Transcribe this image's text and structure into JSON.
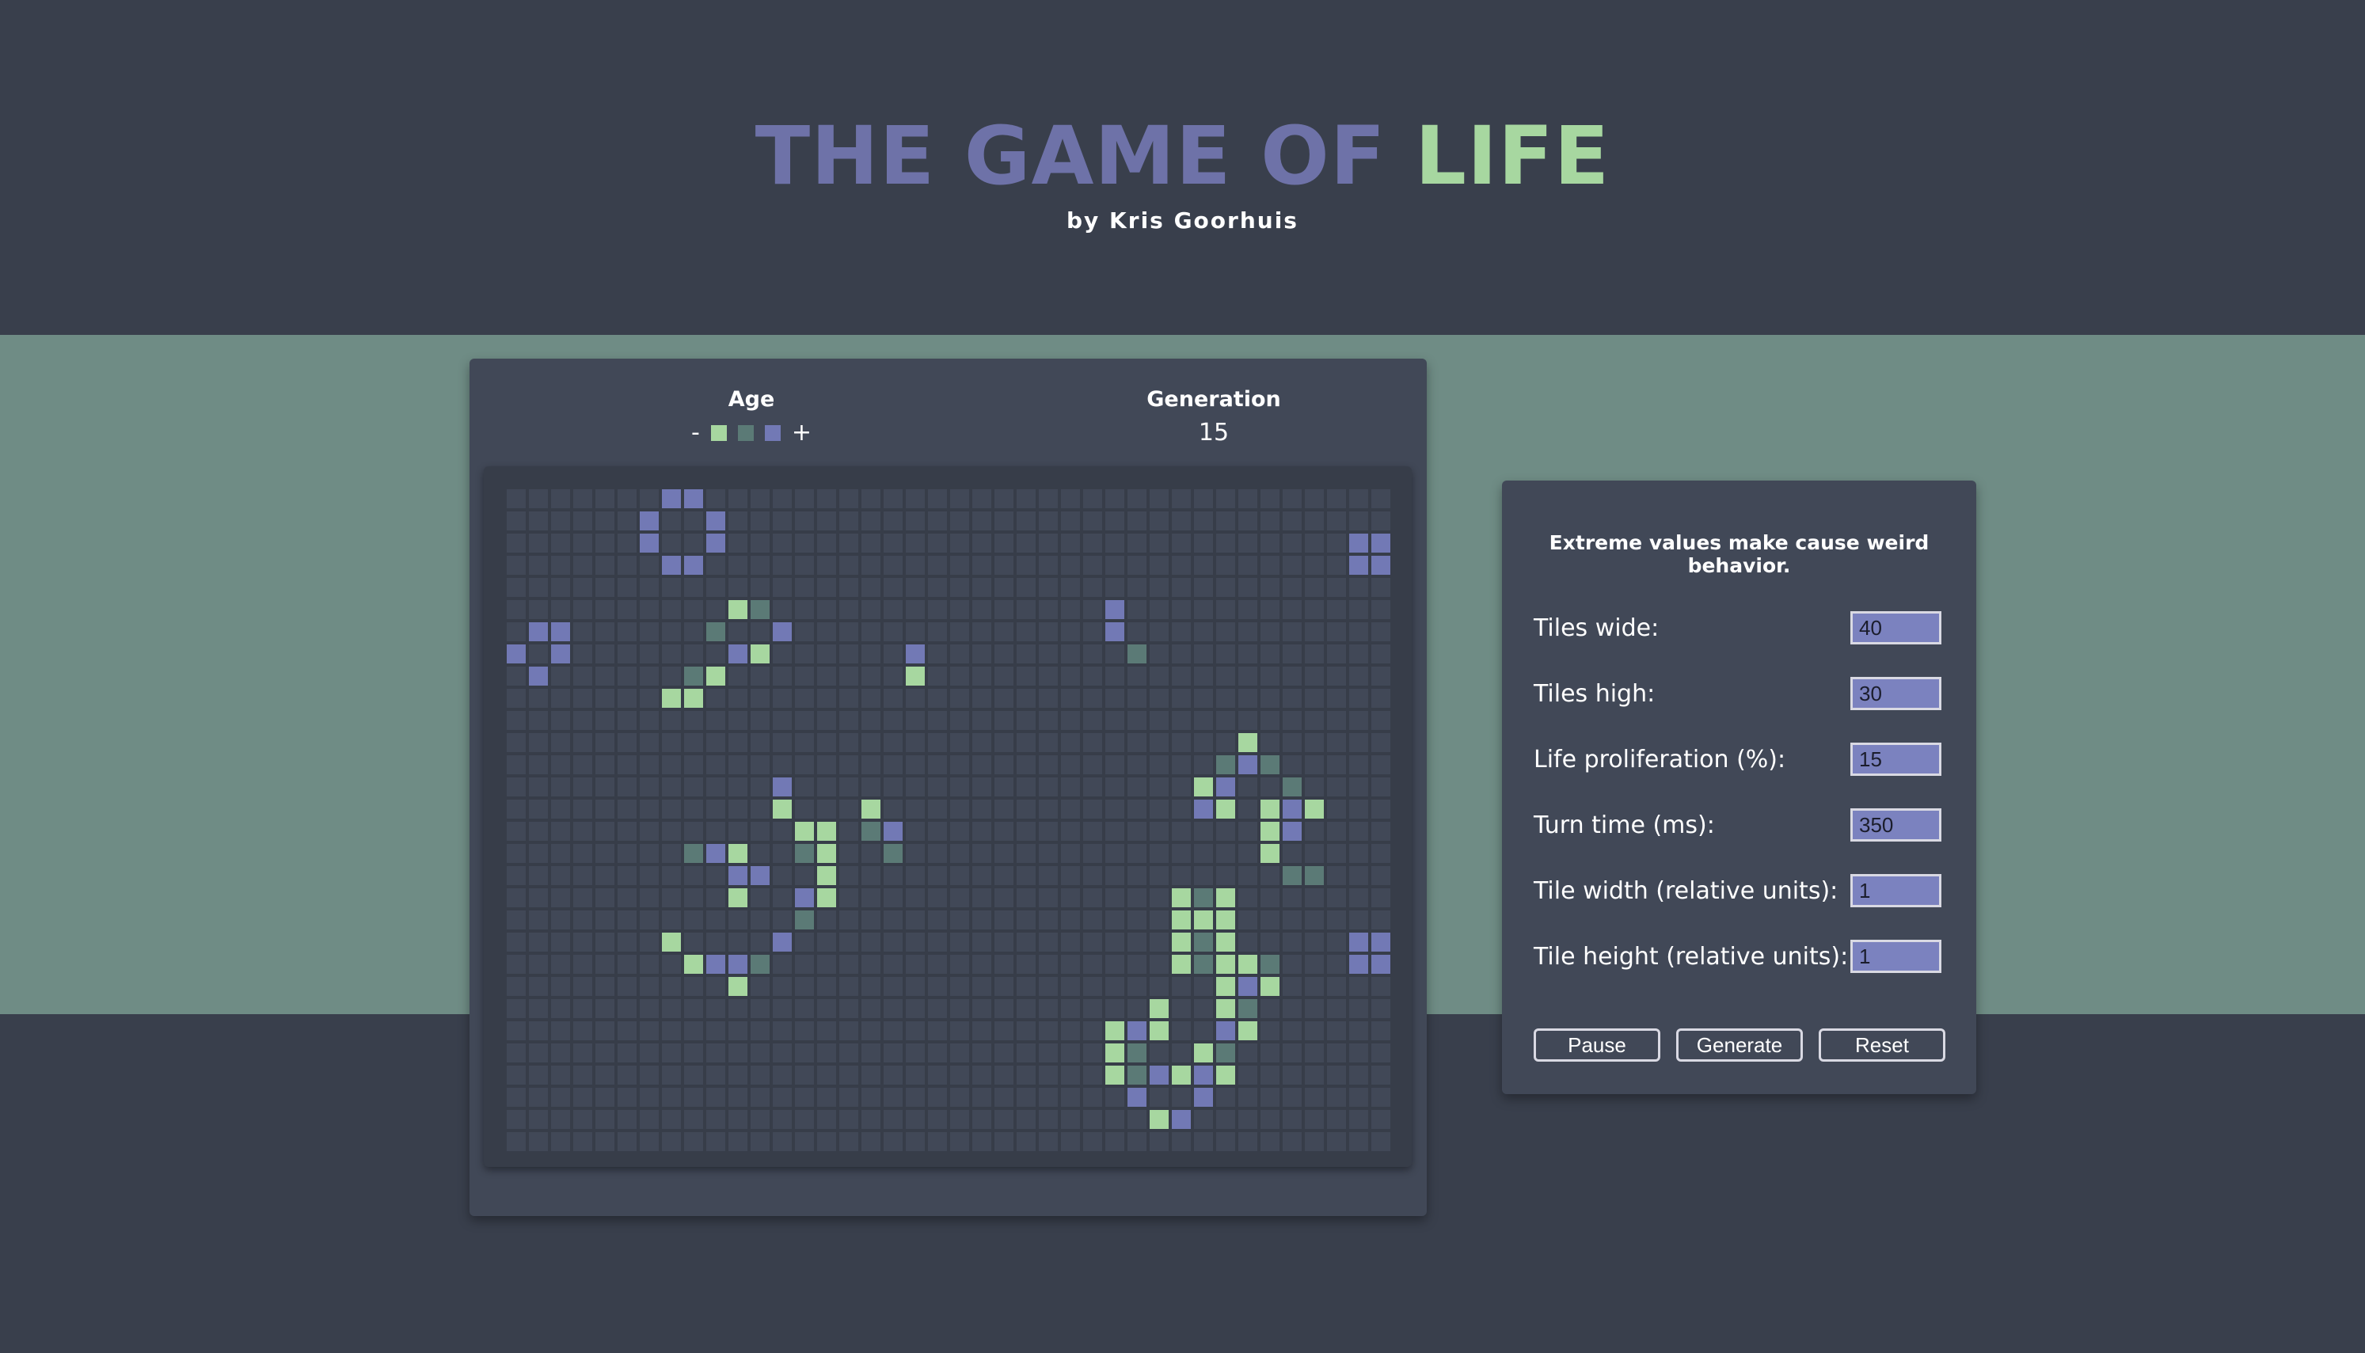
{
  "header": {
    "title_part_a": "THE GAME OF",
    "title_part_b": "LIFE",
    "subtitle": "by Kris Goorhuis"
  },
  "stats": {
    "age_label": "Age",
    "age_minus": "-",
    "age_plus": "+",
    "generation_label": "Generation",
    "generation_value": "15"
  },
  "colors": {
    "background": "#393f4c",
    "band": "#6f8c85",
    "panel": "#414857",
    "cell_empty": "#414857",
    "gridline": "#373d49",
    "cell_young": "#a7d7a0",
    "cell_mid": "#5b7a76",
    "cell_old": "#7279b5",
    "title_accent": "#6e72a8",
    "title_life": "#a7d7a0"
  },
  "age_swatches": [
    "young",
    "mid",
    "old"
  ],
  "board": {
    "cols": 40,
    "rows": 30,
    "cells": [
      [
        7,
        0,
        "old"
      ],
      [
        8,
        0,
        "old"
      ],
      [
        6,
        1,
        "old"
      ],
      [
        9,
        1,
        "old"
      ],
      [
        6,
        2,
        "old"
      ],
      [
        9,
        2,
        "old"
      ],
      [
        7,
        3,
        "old"
      ],
      [
        8,
        3,
        "old"
      ],
      [
        38,
        2,
        "old"
      ],
      [
        39,
        2,
        "old"
      ],
      [
        38,
        3,
        "old"
      ],
      [
        39,
        3,
        "old"
      ],
      [
        10,
        5,
        "young"
      ],
      [
        11,
        5,
        "mid"
      ],
      [
        9,
        6,
        "mid"
      ],
      [
        12,
        6,
        "old"
      ],
      [
        10,
        7,
        "old"
      ],
      [
        11,
        7,
        "young"
      ],
      [
        8,
        8,
        "mid"
      ],
      [
        9,
        8,
        "young"
      ],
      [
        7,
        9,
        "young"
      ],
      [
        8,
        9,
        "young"
      ],
      [
        1,
        6,
        "old"
      ],
      [
        2,
        6,
        "old"
      ],
      [
        0,
        7,
        "old"
      ],
      [
        2,
        7,
        "old"
      ],
      [
        1,
        8,
        "old"
      ],
      [
        18,
        7,
        "old"
      ],
      [
        18,
        8,
        "young"
      ],
      [
        27,
        5,
        "old"
      ],
      [
        27,
        6,
        "old"
      ],
      [
        28,
        7,
        "mid"
      ],
      [
        33,
        11,
        "young"
      ],
      [
        32,
        12,
        "mid"
      ],
      [
        33,
        12,
        "old"
      ],
      [
        34,
        12,
        "mid"
      ],
      [
        31,
        13,
        "young"
      ],
      [
        32,
        13,
        "old"
      ],
      [
        35,
        13,
        "mid"
      ],
      [
        31,
        14,
        "old"
      ],
      [
        32,
        14,
        "young"
      ],
      [
        34,
        14,
        "young"
      ],
      [
        35,
        14,
        "old"
      ],
      [
        36,
        14,
        "young"
      ],
      [
        34,
        15,
        "young"
      ],
      [
        35,
        15,
        "old"
      ],
      [
        34,
        16,
        "young"
      ],
      [
        35,
        17,
        "mid"
      ],
      [
        36,
        17,
        "mid"
      ],
      [
        12,
        13,
        "old"
      ],
      [
        12,
        14,
        "young"
      ],
      [
        13,
        15,
        "young"
      ],
      [
        14,
        15,
        "young"
      ],
      [
        16,
        14,
        "young"
      ],
      [
        16,
        15,
        "mid"
      ],
      [
        17,
        15,
        "old"
      ],
      [
        13,
        16,
        "mid"
      ],
      [
        14,
        16,
        "young"
      ],
      [
        17,
        16,
        "mid"
      ],
      [
        8,
        16,
        "mid"
      ],
      [
        9,
        16,
        "old"
      ],
      [
        10,
        16,
        "young"
      ],
      [
        10,
        17,
        "old"
      ],
      [
        11,
        17,
        "old"
      ],
      [
        14,
        17,
        "young"
      ],
      [
        10,
        18,
        "young"
      ],
      [
        13,
        18,
        "old"
      ],
      [
        14,
        18,
        "young"
      ],
      [
        13,
        19,
        "mid"
      ],
      [
        7,
        20,
        "young"
      ],
      [
        12,
        20,
        "old"
      ],
      [
        8,
        21,
        "young"
      ],
      [
        9,
        21,
        "old"
      ],
      [
        10,
        21,
        "old"
      ],
      [
        11,
        21,
        "mid"
      ],
      [
        10,
        22,
        "young"
      ],
      [
        30,
        18,
        "young"
      ],
      [
        31,
        18,
        "mid"
      ],
      [
        32,
        18,
        "young"
      ],
      [
        30,
        19,
        "young"
      ],
      [
        31,
        19,
        "young"
      ],
      [
        32,
        19,
        "young"
      ],
      [
        30,
        20,
        "young"
      ],
      [
        31,
        20,
        "mid"
      ],
      [
        32,
        20,
        "young"
      ],
      [
        30,
        21,
        "young"
      ],
      [
        31,
        21,
        "mid"
      ],
      [
        32,
        21,
        "young"
      ],
      [
        33,
        21,
        "young"
      ],
      [
        34,
        21,
        "mid"
      ],
      [
        32,
        22,
        "young"
      ],
      [
        33,
        22,
        "old"
      ],
      [
        34,
        22,
        "young"
      ],
      [
        32,
        23,
        "young"
      ],
      [
        33,
        23,
        "mid"
      ],
      [
        32,
        24,
        "old"
      ],
      [
        33,
        24,
        "young"
      ],
      [
        38,
        20,
        "old"
      ],
      [
        39,
        20,
        "old"
      ],
      [
        38,
        21,
        "old"
      ],
      [
        39,
        21,
        "old"
      ],
      [
        29,
        23,
        "young"
      ],
      [
        27,
        24,
        "young"
      ],
      [
        28,
        24,
        "old"
      ],
      [
        29,
        24,
        "young"
      ],
      [
        27,
        25,
        "young"
      ],
      [
        28,
        25,
        "mid"
      ],
      [
        31,
        25,
        "young"
      ],
      [
        32,
        25,
        "mid"
      ],
      [
        27,
        26,
        "young"
      ],
      [
        28,
        26,
        "mid"
      ],
      [
        29,
        26,
        "old"
      ],
      [
        30,
        26,
        "young"
      ],
      [
        31,
        26,
        "old"
      ],
      [
        32,
        26,
        "young"
      ],
      [
        28,
        27,
        "old"
      ],
      [
        31,
        27,
        "old"
      ],
      [
        29,
        28,
        "young"
      ],
      [
        30,
        28,
        "old"
      ]
    ]
  },
  "settings": {
    "warning": "Extreme values make cause weird behavior.",
    "rows": [
      {
        "label": "Tiles wide:",
        "value": "40"
      },
      {
        "label": "Tiles high:",
        "value": "30"
      },
      {
        "label": "Life proliferation (%):",
        "value": "15"
      },
      {
        "label": "Turn time (ms):",
        "value": "350"
      },
      {
        "label": "Tile width (relative units):",
        "value": "1"
      },
      {
        "label": "Tile height (relative units):",
        "value": "1"
      }
    ],
    "buttons": {
      "pause": "Pause",
      "generate": "Generate",
      "reset": "Reset"
    }
  }
}
